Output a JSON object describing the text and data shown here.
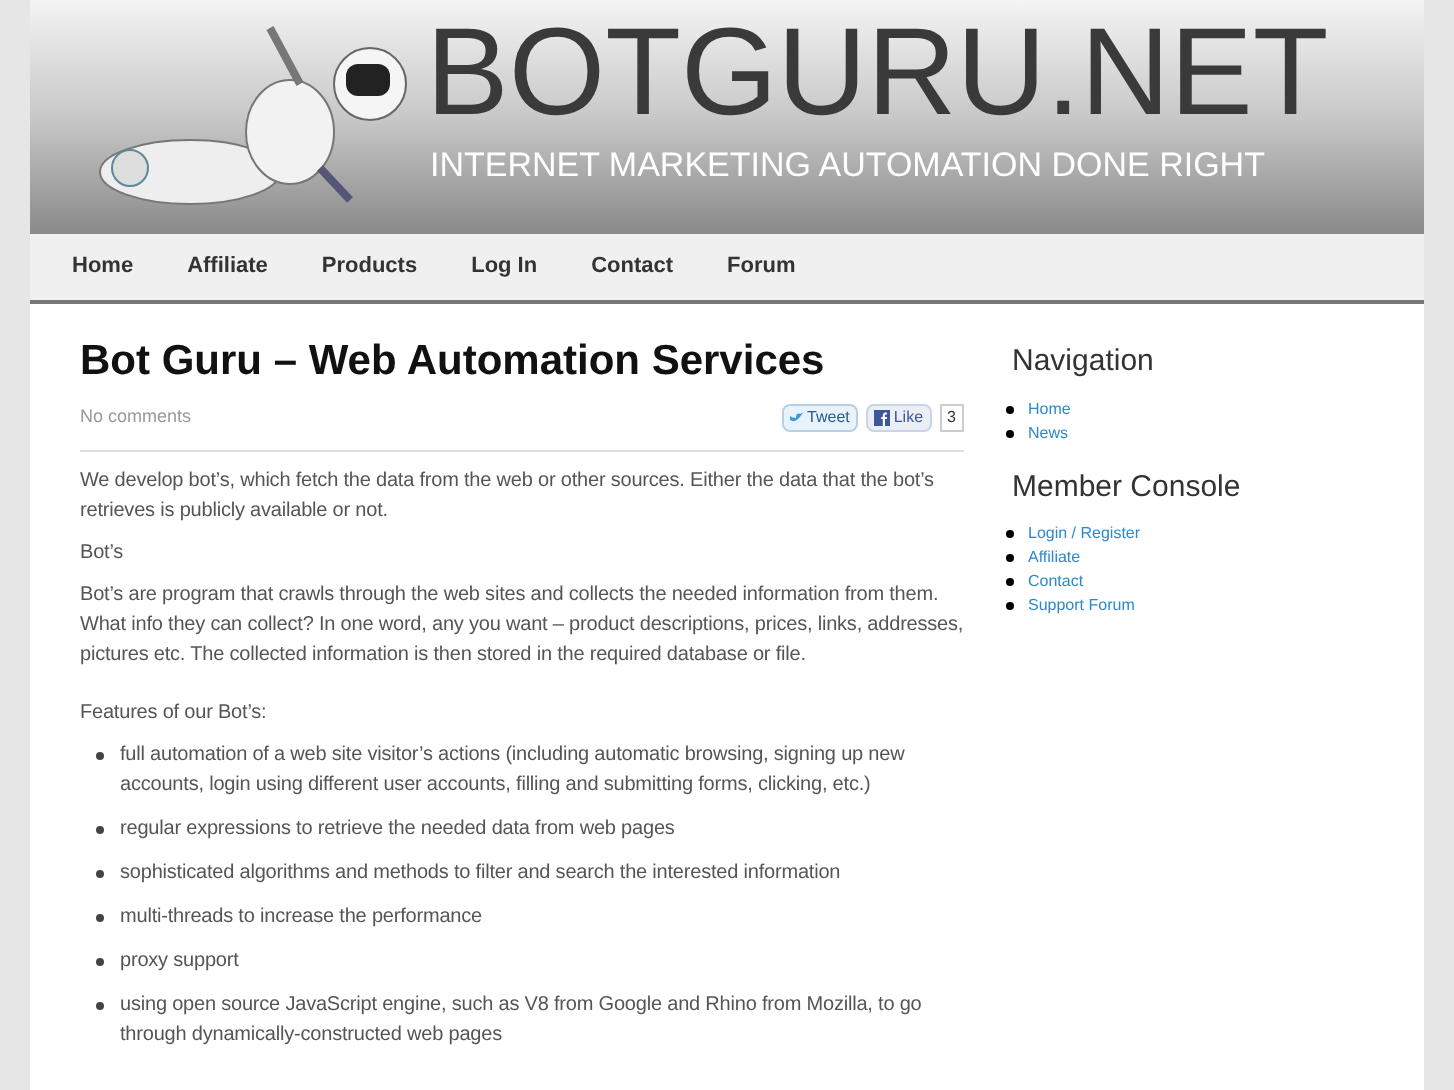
{
  "header": {
    "logo": "BOTGURU.NET",
    "tagline": "INTERNET MARKETING AUTOMATION DONE RIGHT"
  },
  "nav": [
    {
      "label": "Home"
    },
    {
      "label": "Affiliate"
    },
    {
      "label": "Products"
    },
    {
      "label": "Log In"
    },
    {
      "label": "Contact"
    },
    {
      "label": "Forum"
    }
  ],
  "post": {
    "title": "Bot Guru – Web Automation Services",
    "comments": "No comments",
    "tweet": "Tweet",
    "like": "Like",
    "like_count": "3",
    "paragraphs": [
      "We develop bot’s, which fetch the data from the web or other sources. Either the data that the bot’s retrieves is publicly available or not.",
      "Bot’s",
      "Bot’s are program that crawls through the web sites and collects the needed information from them. What info they can collect? In one word, any you want – product descriptions, prices, links, addresses, pictures etc. The collected information is then stored in the required database or file."
    ],
    "features_heading": "Features of our Bot’s:",
    "features": [
      "full automation of a web site visitor’s actions (including automatic browsing, signing up new accounts, login using different user accounts, filling and submitting forms, clicking, etc.)",
      "regular expressions to retrieve the needed data from web pages",
      "sophisticated algorithms and methods to filter and search the interested information",
      "multi-threads to increase the performance",
      "proxy support",
      "using open source JavaScript engine, such as V8 from Google and Rhino from Mozilla, to go through dynamically-constructed web pages"
    ]
  },
  "sidebar": [
    {
      "title": "Navigation",
      "links": [
        "Home",
        "News"
      ]
    },
    {
      "title": "Member Console",
      "links": [
        "Login / Register",
        "Affiliate",
        "Contact",
        "Support Forum"
      ]
    }
  ]
}
